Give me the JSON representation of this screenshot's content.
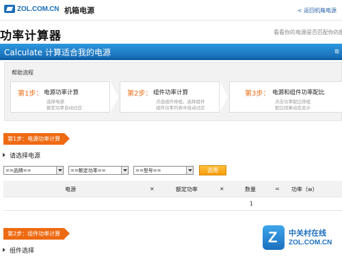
{
  "header": {
    "logo_text": "ZOL.COM.CN",
    "site_name": "机箱电源",
    "back_link": "< 返回机箱电源"
  },
  "page": {
    "title": "功率计算器",
    "right_hint": "看看你的电源是否匹配你的配件"
  },
  "banner": {
    "title": "Calculate 计算适合我的电源",
    "right": "帮"
  },
  "help": {
    "title": "帮助流程",
    "steps": [
      {
        "num": "第1步：",
        "head": "电源功率计算",
        "sub1": "选择电源",
        "sub2": "额定功率自动过应"
      },
      {
        "num": "第2步：",
        "head": "组件功率计算",
        "sub1": "点选组件排组，选择组件",
        "sub2": "组件功率列表中自动过应"
      },
      {
        "num": "第3步：",
        "head": "电源和组件功率配比",
        "sub1": "点击功率配比排组",
        "sub2": "配比结果动态显示"
      }
    ]
  },
  "section1": {
    "badge": "第1步：电源功率计算",
    "subhead": "请选择电源",
    "selects": [
      "==品牌==",
      "==额定功率==",
      "==型号=="
    ],
    "choose_button": "选用",
    "columns": [
      "电源",
      "×",
      "额定功率",
      "×",
      "数量",
      "=",
      "功率（w）"
    ],
    "row": {
      "quantity": "1"
    }
  },
  "section2": {
    "badge": "第2步：组件功率计算",
    "subhead": "组件选择"
  },
  "watermark": {
    "cn": "中关村在线",
    "en": "ZOL.COM.CN"
  },
  "colors": {
    "accent_orange": "#ee6a12",
    "banner_blue": "#1a78c2"
  }
}
